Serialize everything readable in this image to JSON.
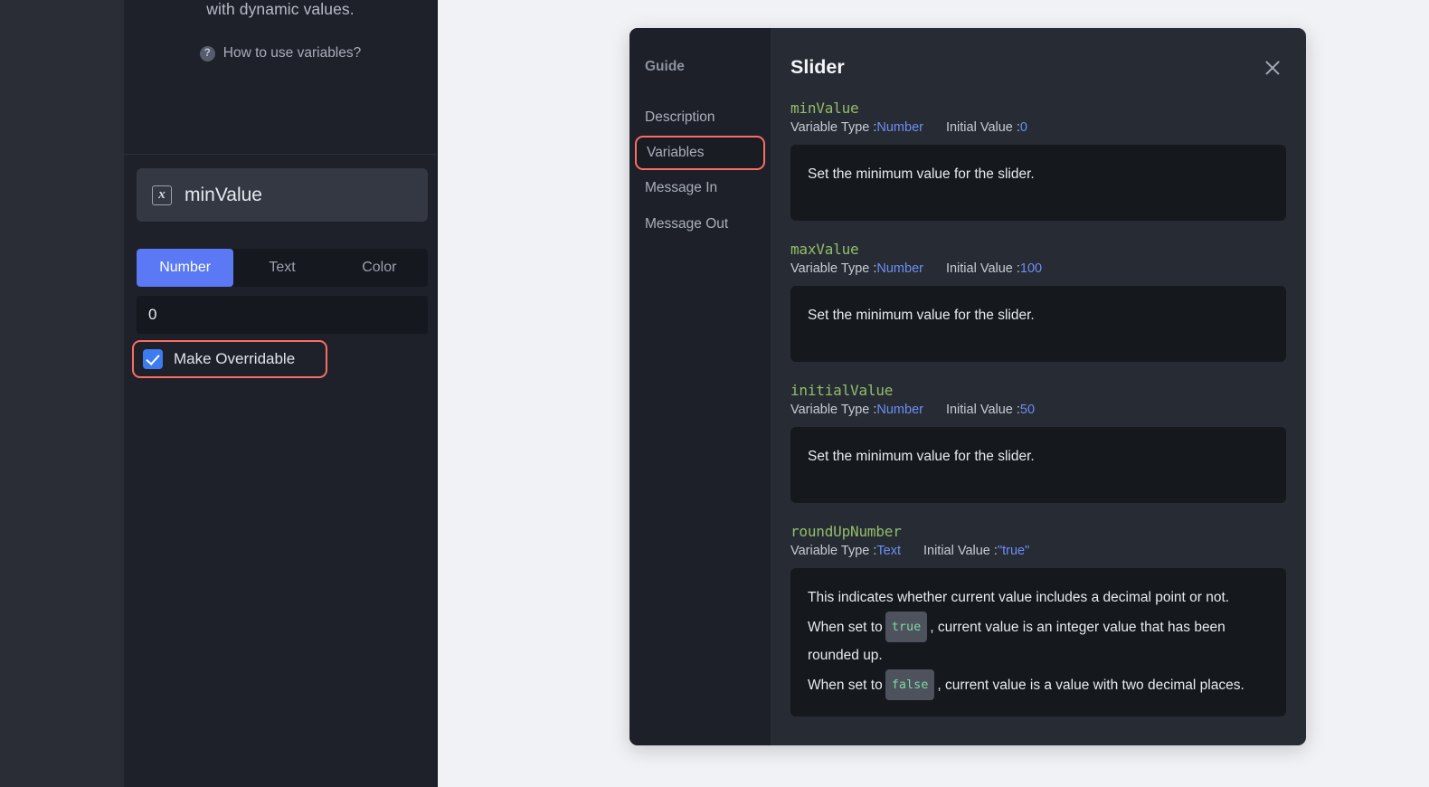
{
  "editor": {
    "description_tail": "with dynamic values.",
    "help_link": "How to use variables?",
    "help_icon": "question-circle-icon",
    "variable_icon": "variable-x-icon",
    "variable_name": "minValue",
    "type_tabs": [
      {
        "label": "Number",
        "active": true
      },
      {
        "label": "Text",
        "active": false
      },
      {
        "label": "Color",
        "active": false
      }
    ],
    "value": "0",
    "value_placeholder": "0",
    "overridable_label": "Make Overridable",
    "overridable_checked": true
  },
  "modal": {
    "sidebar_title": "Guide",
    "nav_items": [
      {
        "label": "Description",
        "highlighted": false
      },
      {
        "label": "Variables",
        "highlighted": true
      },
      {
        "label": "Message In",
        "highlighted": false
      },
      {
        "label": "Message Out",
        "highlighted": false
      }
    ],
    "title": "Slider",
    "close_icon": "close-icon",
    "meta_type_label": "Variable Type : ",
    "meta_initial_label": "Initial Value : ",
    "variables": [
      {
        "name": "minValue",
        "type": "Number",
        "initial": "0",
        "description": "Set the minimum value for the slider."
      },
      {
        "name": "maxValue",
        "type": "Number",
        "initial": "100",
        "description": "Set the minimum value for the slider."
      },
      {
        "name": "initialValue",
        "type": "Number",
        "initial": "50",
        "description": "Set the minimum value for the slider."
      },
      {
        "name": "roundUpNumber",
        "type": "Text",
        "initial": "\"true\"",
        "description_line1": "This indicates whether current value includes a decimal point or not.",
        "description_line2a": "When set to",
        "chip_true": "true",
        "description_line2b": ", current value is an integer value that has been rounded up.",
        "description_line3a": "When set to",
        "chip_false": "false",
        "description_line3b": ", current value is a value with two decimal places."
      }
    ]
  },
  "colors": {
    "accent_blue": "#5b79f5",
    "highlight_red": "#fa6d63",
    "var_name_green": "#93bd6a",
    "value_blue": "#6d8ef5",
    "chip_green": "#7fd6a6",
    "canvas_bg": "#f1f2f6",
    "panel_bg": "#1e212a",
    "modal_bg": "#272b34"
  }
}
